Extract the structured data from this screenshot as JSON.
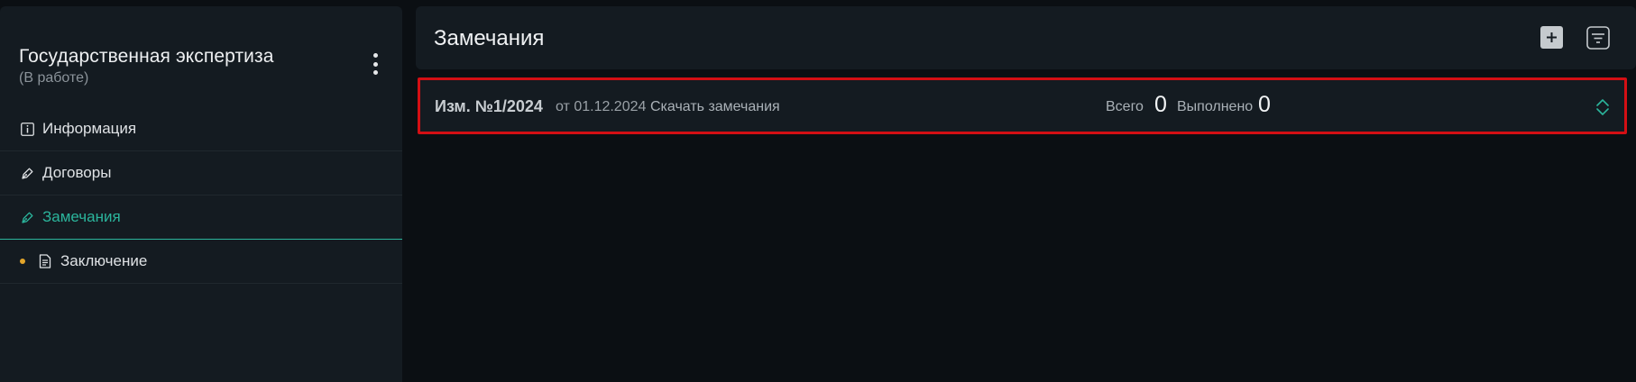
{
  "sidebar": {
    "title": "Государственная экспертиза",
    "status": "(В работе)",
    "items": [
      {
        "label": "Информация",
        "icon": "info-icon"
      },
      {
        "label": "Договоры",
        "icon": "pen-icon"
      },
      {
        "label": "Замечания",
        "icon": "pen-icon",
        "active": true
      },
      {
        "label": "Заключение",
        "icon": "document-icon",
        "indicator": "dot"
      }
    ]
  },
  "main": {
    "title": "Замечания",
    "row": {
      "revision": "Изм. №1/2024",
      "date": "от 01.12.2024",
      "download_label": "Скачать замечания",
      "total_label": "Всего",
      "total_value": "0",
      "done_label": "Выполнено",
      "done_value": "0"
    }
  },
  "colors": {
    "accent": "#2bb59c",
    "highlight_border": "#d40f14",
    "indicator_dot": "#e3a52a",
    "panel": "#141b21",
    "background": "#0b0f13"
  }
}
